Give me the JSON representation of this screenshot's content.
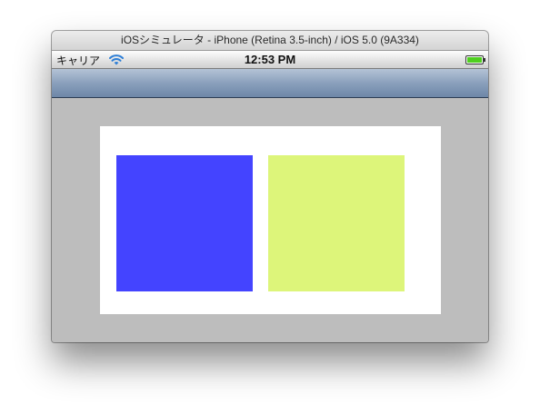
{
  "window": {
    "title": "iOSシミュレータ - iPhone (Retina 3.5-inch) / iOS 5.0 (9A334)"
  },
  "status_bar": {
    "carrier": "キャリア",
    "time": "12:53 PM",
    "icons": [
      "wifi-icon",
      "battery-icon"
    ]
  },
  "colors": {
    "nav_bar": "#8aa0bc",
    "background": "#bdbdbd",
    "panel": "#ffffff",
    "square_left": "#4444ff",
    "square_right": "#ddf57a",
    "battery": "#4fcf1f"
  }
}
